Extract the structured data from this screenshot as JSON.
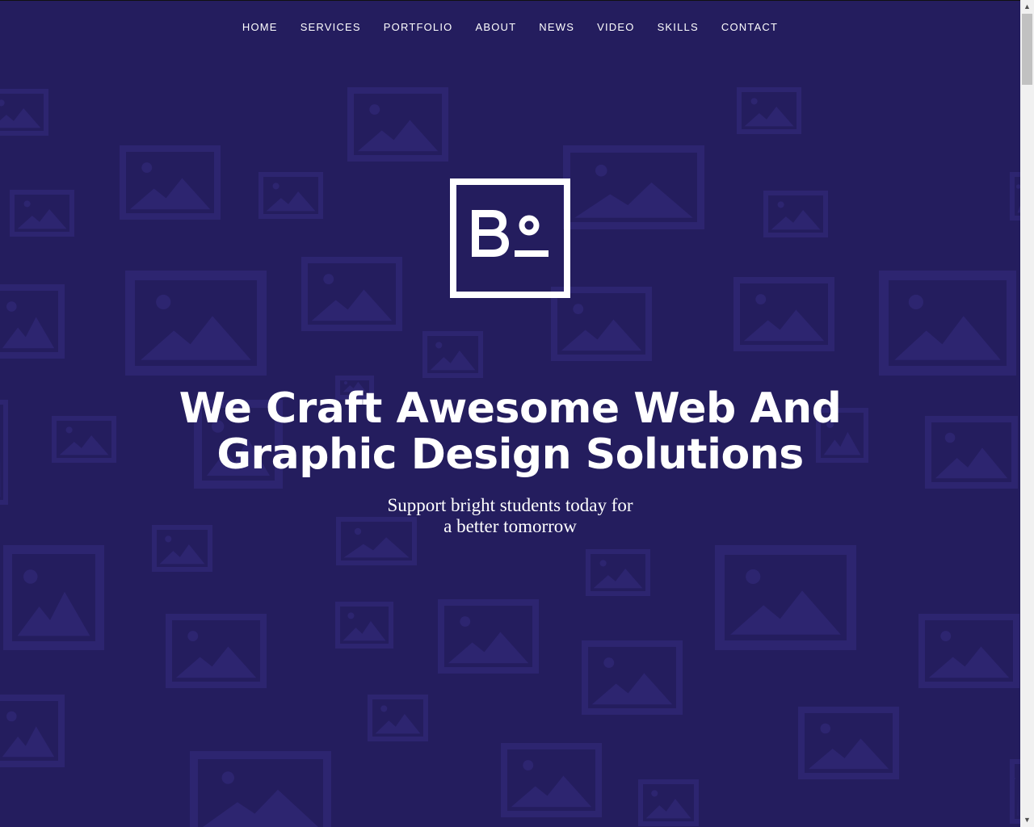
{
  "nav": {
    "items": [
      "HOME",
      "SERVICES",
      "PORTFOLIO",
      "ABOUT",
      "NEWS",
      "VIDEO",
      "SKILLS",
      "CONTACT"
    ]
  },
  "hero": {
    "logo_icon": "bo-logo",
    "headline_line1": "We Craft Awesome Web And",
    "headline_line2": "Graphic Design Solutions",
    "subtitle_line1": "Support bright students today for",
    "subtitle_line2": "a better tomorrow"
  },
  "colors": {
    "background": "#241d5e",
    "pattern": "#2d2570",
    "text": "#ffffff"
  }
}
